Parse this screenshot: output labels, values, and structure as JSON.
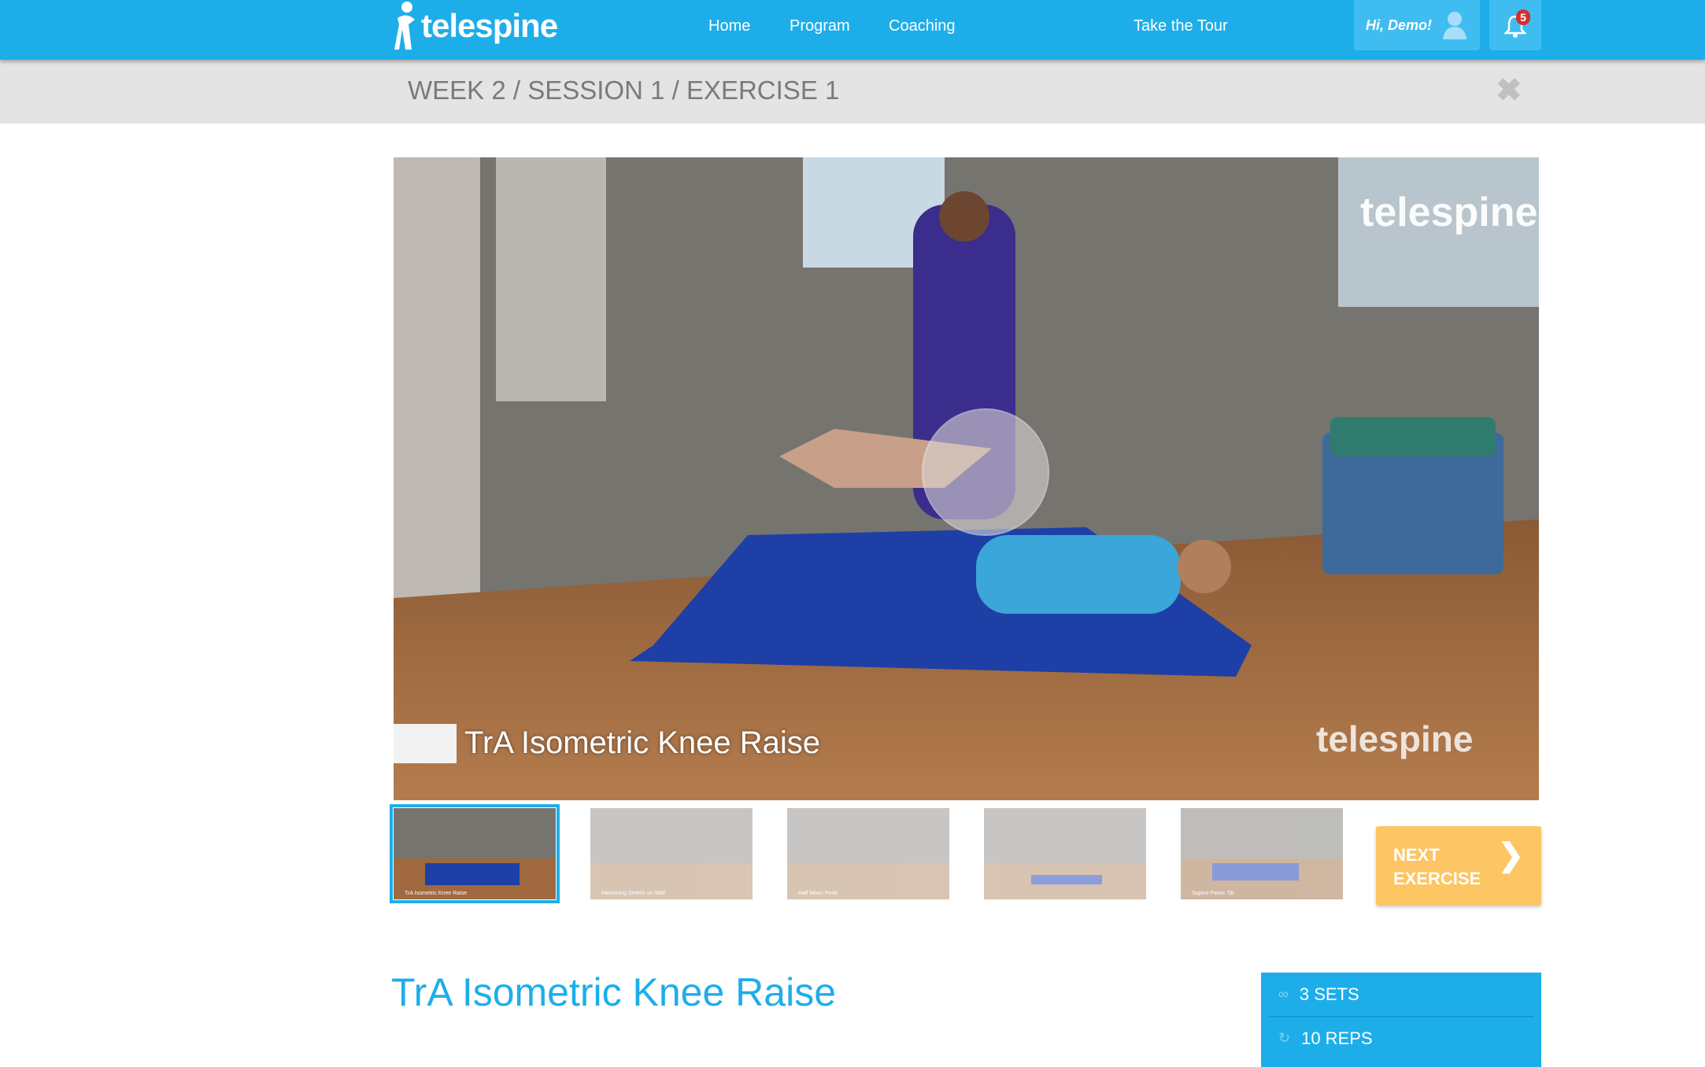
{
  "header": {
    "logo": "telespine",
    "nav": [
      "Home",
      "Program",
      "Coaching",
      "Take the Tour"
    ],
    "greeting": "Hi, Demo!",
    "notification_count": "5"
  },
  "breadcrumb": "WEEK 2 / SESSION 1 / EXERCISE 1",
  "video": {
    "caption": "TrA Isometric Knee Raise",
    "watermark": "telespine"
  },
  "thumbnails": [
    {
      "caption": "TrA Isometric Knee Raise",
      "selected": true
    },
    {
      "caption": "Hamstring Stretch on Wall",
      "selected": false
    },
    {
      "caption": "Half Moon Pose",
      "selected": false
    },
    {
      "caption": "",
      "selected": false
    },
    {
      "caption": "Supine Pelvic Tilt",
      "selected": false
    }
  ],
  "next_button": {
    "line1": "NEXT",
    "line2": "EXERCISE"
  },
  "exercise": {
    "title": "TrA Isometric Knee Raise",
    "sets": "3 SETS",
    "reps": "10 REPS"
  },
  "colors": {
    "brand": "#1daeea",
    "next": "#fdc563"
  }
}
